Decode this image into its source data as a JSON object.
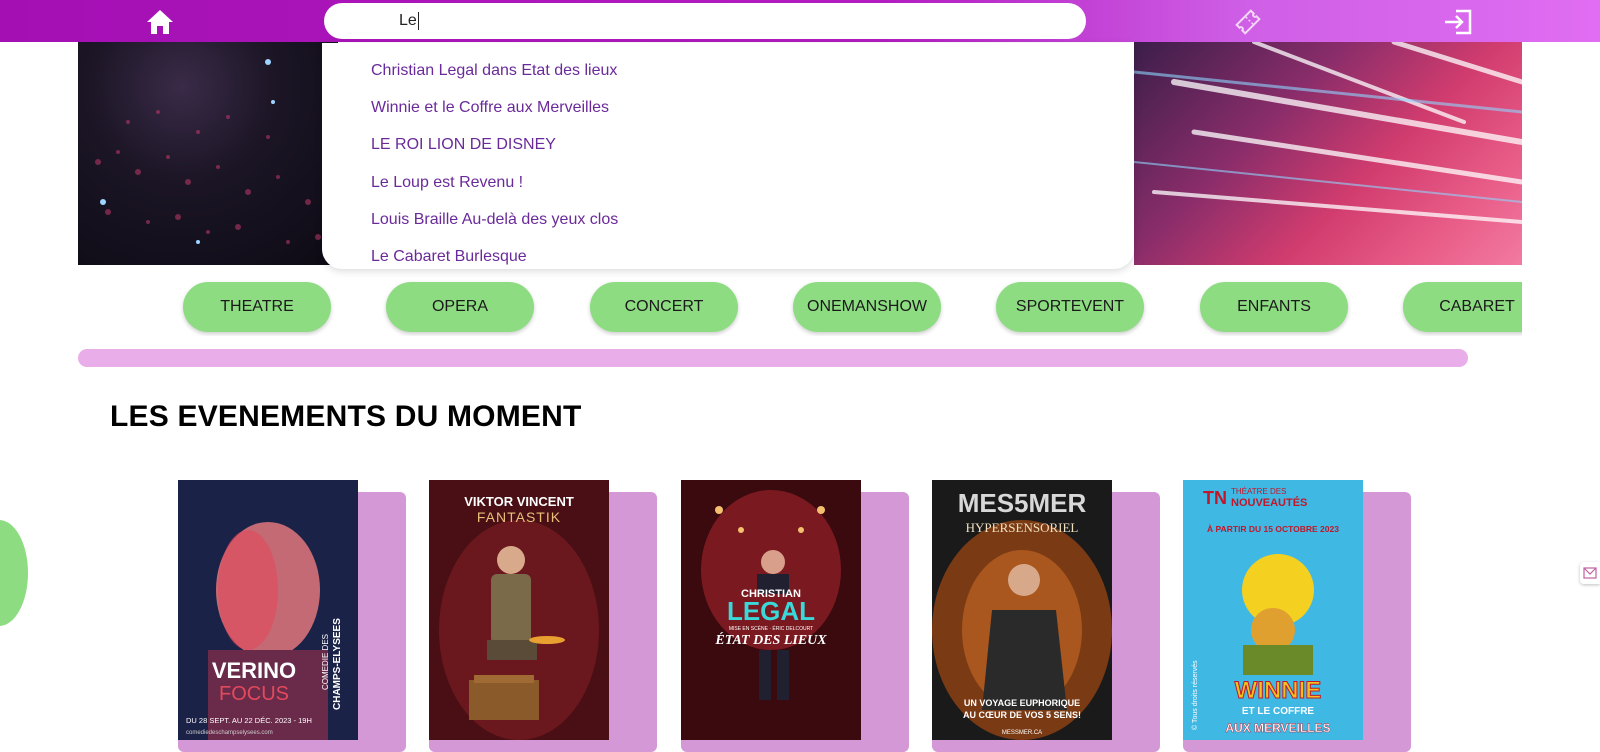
{
  "search": {
    "query": "Le"
  },
  "suggestions": [
    "Christian Legal dans Etat des lieux",
    "Winnie et le Coffre aux Merveilles",
    "LE ROI LION DE DISNEY",
    "Le Loup est Revenu !",
    "Louis Braille Au-delà des yeux clos",
    "Le Cabaret Burlesque"
  ],
  "categories": [
    "THEATRE",
    "OPERA",
    "CONCERT",
    "ONEMANSHOW",
    "SPORTEVENT",
    "ENFANTS",
    "CABARET"
  ],
  "section": {
    "title": "LES EVENEMENTS DU MOMENT"
  },
  "posters": {
    "p1": {
      "line1": "VERINO",
      "line2": "FOCUS",
      "venue1": "COMEDIE DES",
      "venue2": "CHAMPS-ELYSEES",
      "dates": "DU 28 SEPT. AU 22 DÉC. 2023 - 19H",
      "url": "comediedeschampselysees.com"
    },
    "p2": {
      "line1": "VIKTOR VINCENT",
      "line2": "FANTASTIK"
    },
    "p3": {
      "line1": "CHRISTIAN",
      "line2": "LEGAL",
      "credits": "MISE EN SCÈNE · ÉRIC DELCOURT",
      "line3": "ÉTAT DES LIEUX"
    },
    "p4": {
      "line1": "MES5MER",
      "line2": "HYPERSENSORIEL",
      "tagline1": "UN VOYAGE EUPHORIQUE",
      "tagline2": "AU CŒUR DE VOS 5 SENS!",
      "url": "MESSMER.CA"
    },
    "p5": {
      "brand": "TN",
      "venue1": "THÉATRE DES",
      "venue2": "NOUVEAUTÉS",
      "date": "À PARTIR DU 15 OCTOBRE 2023",
      "title1": "WINNIE",
      "title2": "ET LE COFFRE",
      "title3": "AUX MERVEILLES",
      "side": "© Tous droits réservés"
    }
  },
  "colors": {
    "topbar": "#b21cc0",
    "accent_green": "#8ddc82",
    "suggestion_text": "#6a2a9a",
    "card_bg": "#d598d6",
    "scrollbar": "#e9aee9"
  }
}
